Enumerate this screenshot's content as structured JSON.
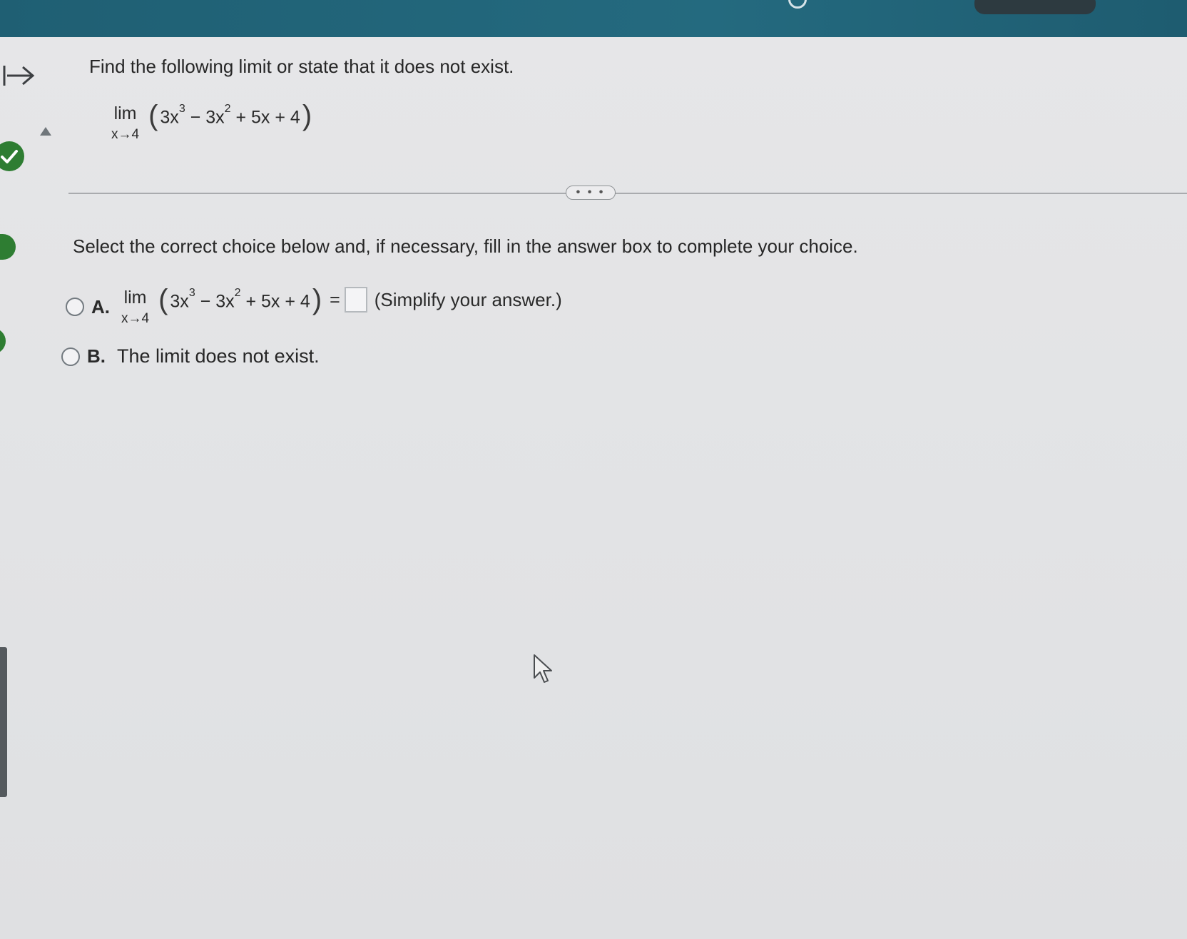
{
  "question": {
    "prompt": "Find the following limit or state that it does not exist.",
    "limit": {
      "lim": "lim",
      "approach": "x→4",
      "open_paren": "(",
      "close_paren": ")",
      "term1": "3x",
      "exp1": "3",
      "term2": " − 3x",
      "exp2": "2",
      "term3": " + 5x + 4"
    }
  },
  "more_button": {
    "label": "• • •"
  },
  "instruction": "Select the correct choice below and, if necessary, fill in the answer box to complete your choice.",
  "choices": [
    {
      "letter": "A.",
      "lim": "lim",
      "approach": "x→4",
      "open_paren": "(",
      "close_paren": ")",
      "term1": "3x",
      "exp1": "3",
      "term2": " − 3x",
      "exp2": "2",
      "term3": " + 5x + 4",
      "equals": "=",
      "answer_value": "",
      "hint": "(Simplify your answer.)"
    },
    {
      "letter": "B.",
      "text": "The limit does not exist."
    }
  ],
  "colors": {
    "topbar": "#246a7f",
    "check": "#2e7d32",
    "background": "#e4e5e7"
  },
  "icons": [
    "collapse-arrow-icon",
    "up-triangle-icon",
    "check-circle-icon",
    "mouse-cursor-icon"
  ]
}
